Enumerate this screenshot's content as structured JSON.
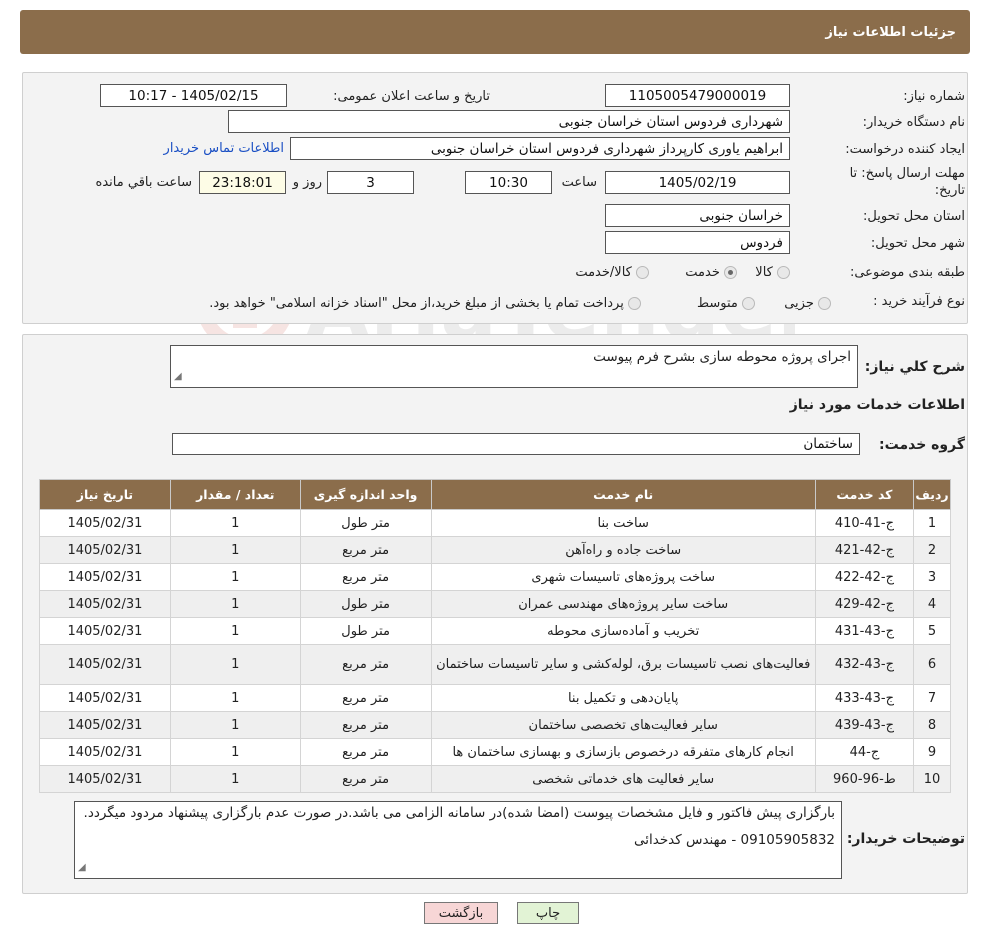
{
  "header": {
    "title": "جزئیات اطلاعات نیاز"
  },
  "details": {
    "need_number_label": "شماره نیاز:",
    "need_number": "1105005479000019",
    "announce_label": "تاریخ و ساعت اعلان عمومی:",
    "announce_value": "1405/02/15 - 10:17",
    "buyer_org_label": "نام دستگاه خریدار:",
    "buyer_org": "شهرداری فردوس استان خراسان جنوبی",
    "requester_label": "ایجاد کننده درخواست:",
    "requester": "ابراهیم یاوری کارپرداز شهرداری فردوس استان خراسان جنوبی",
    "contact_link": "اطلاعات تماس خریدار",
    "deadline_label": "مهلت ارسال پاسخ: تا تاریخ:",
    "deadline_date": "1405/02/19",
    "time_label": "ساعت",
    "deadline_time": "10:30",
    "days_value": "3",
    "days_label": "روز و",
    "remaining_time": "23:18:01",
    "remaining_label": "ساعت باقي مانده",
    "province_label": "استان محل تحویل:",
    "province": "خراسان جنوبی",
    "city_label": "شهر محل تحویل:",
    "city": "فردوس",
    "category_label": "طبقه بندی موضوعی:",
    "category_options": [
      "کالا",
      "خدمت",
      "کالا/خدمت"
    ],
    "process_label": "نوع فرآیند خرید :",
    "process_options": [
      "جزیی",
      "متوسط"
    ],
    "process_note": "پرداخت تمام یا بخشی از مبلغ خرید،از محل \"اسناد خزانه اسلامی\" خواهد بود."
  },
  "summary": {
    "label": "شرح کلي نياز:",
    "value": "اجرای پروژه محوطه سازی بشرح فرم پیوست"
  },
  "services": {
    "section_title": "اطلاعات خدمات مورد نیاز",
    "group_label": "گروه خدمت:",
    "group_value": "ساختمان",
    "columns": [
      "رديف",
      "کد خدمت",
      "نام خدمت",
      "واحد اندازه گیری",
      "تعداد / مقدار",
      "تاریخ نیاز"
    ],
    "rows": [
      [
        "1",
        "ج-41-410",
        "ساخت بنا",
        "متر طول",
        "1",
        "1405/02/31"
      ],
      [
        "2",
        "ج-42-421",
        "ساخت جاده و راه‌آهن",
        "متر مربع",
        "1",
        "1405/02/31"
      ],
      [
        "3",
        "ج-42-422",
        "ساخت پروژه‌های تاسیسات شهری",
        "متر مربع",
        "1",
        "1405/02/31"
      ],
      [
        "4",
        "ج-42-429",
        "ساخت سایر پروژه‌های مهندسی عمران",
        "متر طول",
        "1",
        "1405/02/31"
      ],
      [
        "5",
        "ج-43-431",
        "تخریب و آماده‌سازی محوطه",
        "متر طول",
        "1",
        "1405/02/31"
      ],
      [
        "6",
        "ج-43-432",
        "فعالیت‌های نصب تاسیسات برق، لوله‌کشی و سایر تاسیسات ساختمان",
        "متر مربع",
        "1",
        "1405/02/31"
      ],
      [
        "7",
        "ج-43-433",
        "پایان‌دهی و تکمیل بنا",
        "متر مربع",
        "1",
        "1405/02/31"
      ],
      [
        "8",
        "ج-43-439",
        "سایر فعالیت‌های تخصصی ساختمان",
        "متر مربع",
        "1",
        "1405/02/31"
      ],
      [
        "9",
        "ج-44",
        "انجام کارهای متفرقه درخصوص بازسازی و بهسازی ساختمان ها",
        "متر مربع",
        "1",
        "1405/02/31"
      ],
      [
        "10",
        "ط-96-960",
        "سایر فعالیت های خدماتی شخصی",
        "متر مربع",
        "1",
        "1405/02/31"
      ]
    ]
  },
  "buyer_notes": {
    "label": "توضیحات خریدار:",
    "text": "بارگزاری پیش فاکتور و فایل مشخصات پیوست (امضا شده)در سامانه الزامی می باشد.در صورت عدم بارگزاری پیشنهاد مردود میگردد.",
    "contact": "09105905832    -    مهندس کدخدائی"
  },
  "buttons": {
    "print": "چاپ",
    "back": "بازگشت"
  },
  "colors": {
    "brown": "#8b6d4b",
    "back_button_bg": "#f7d6d6",
    "print_button_bg": "#e2f3d5"
  }
}
